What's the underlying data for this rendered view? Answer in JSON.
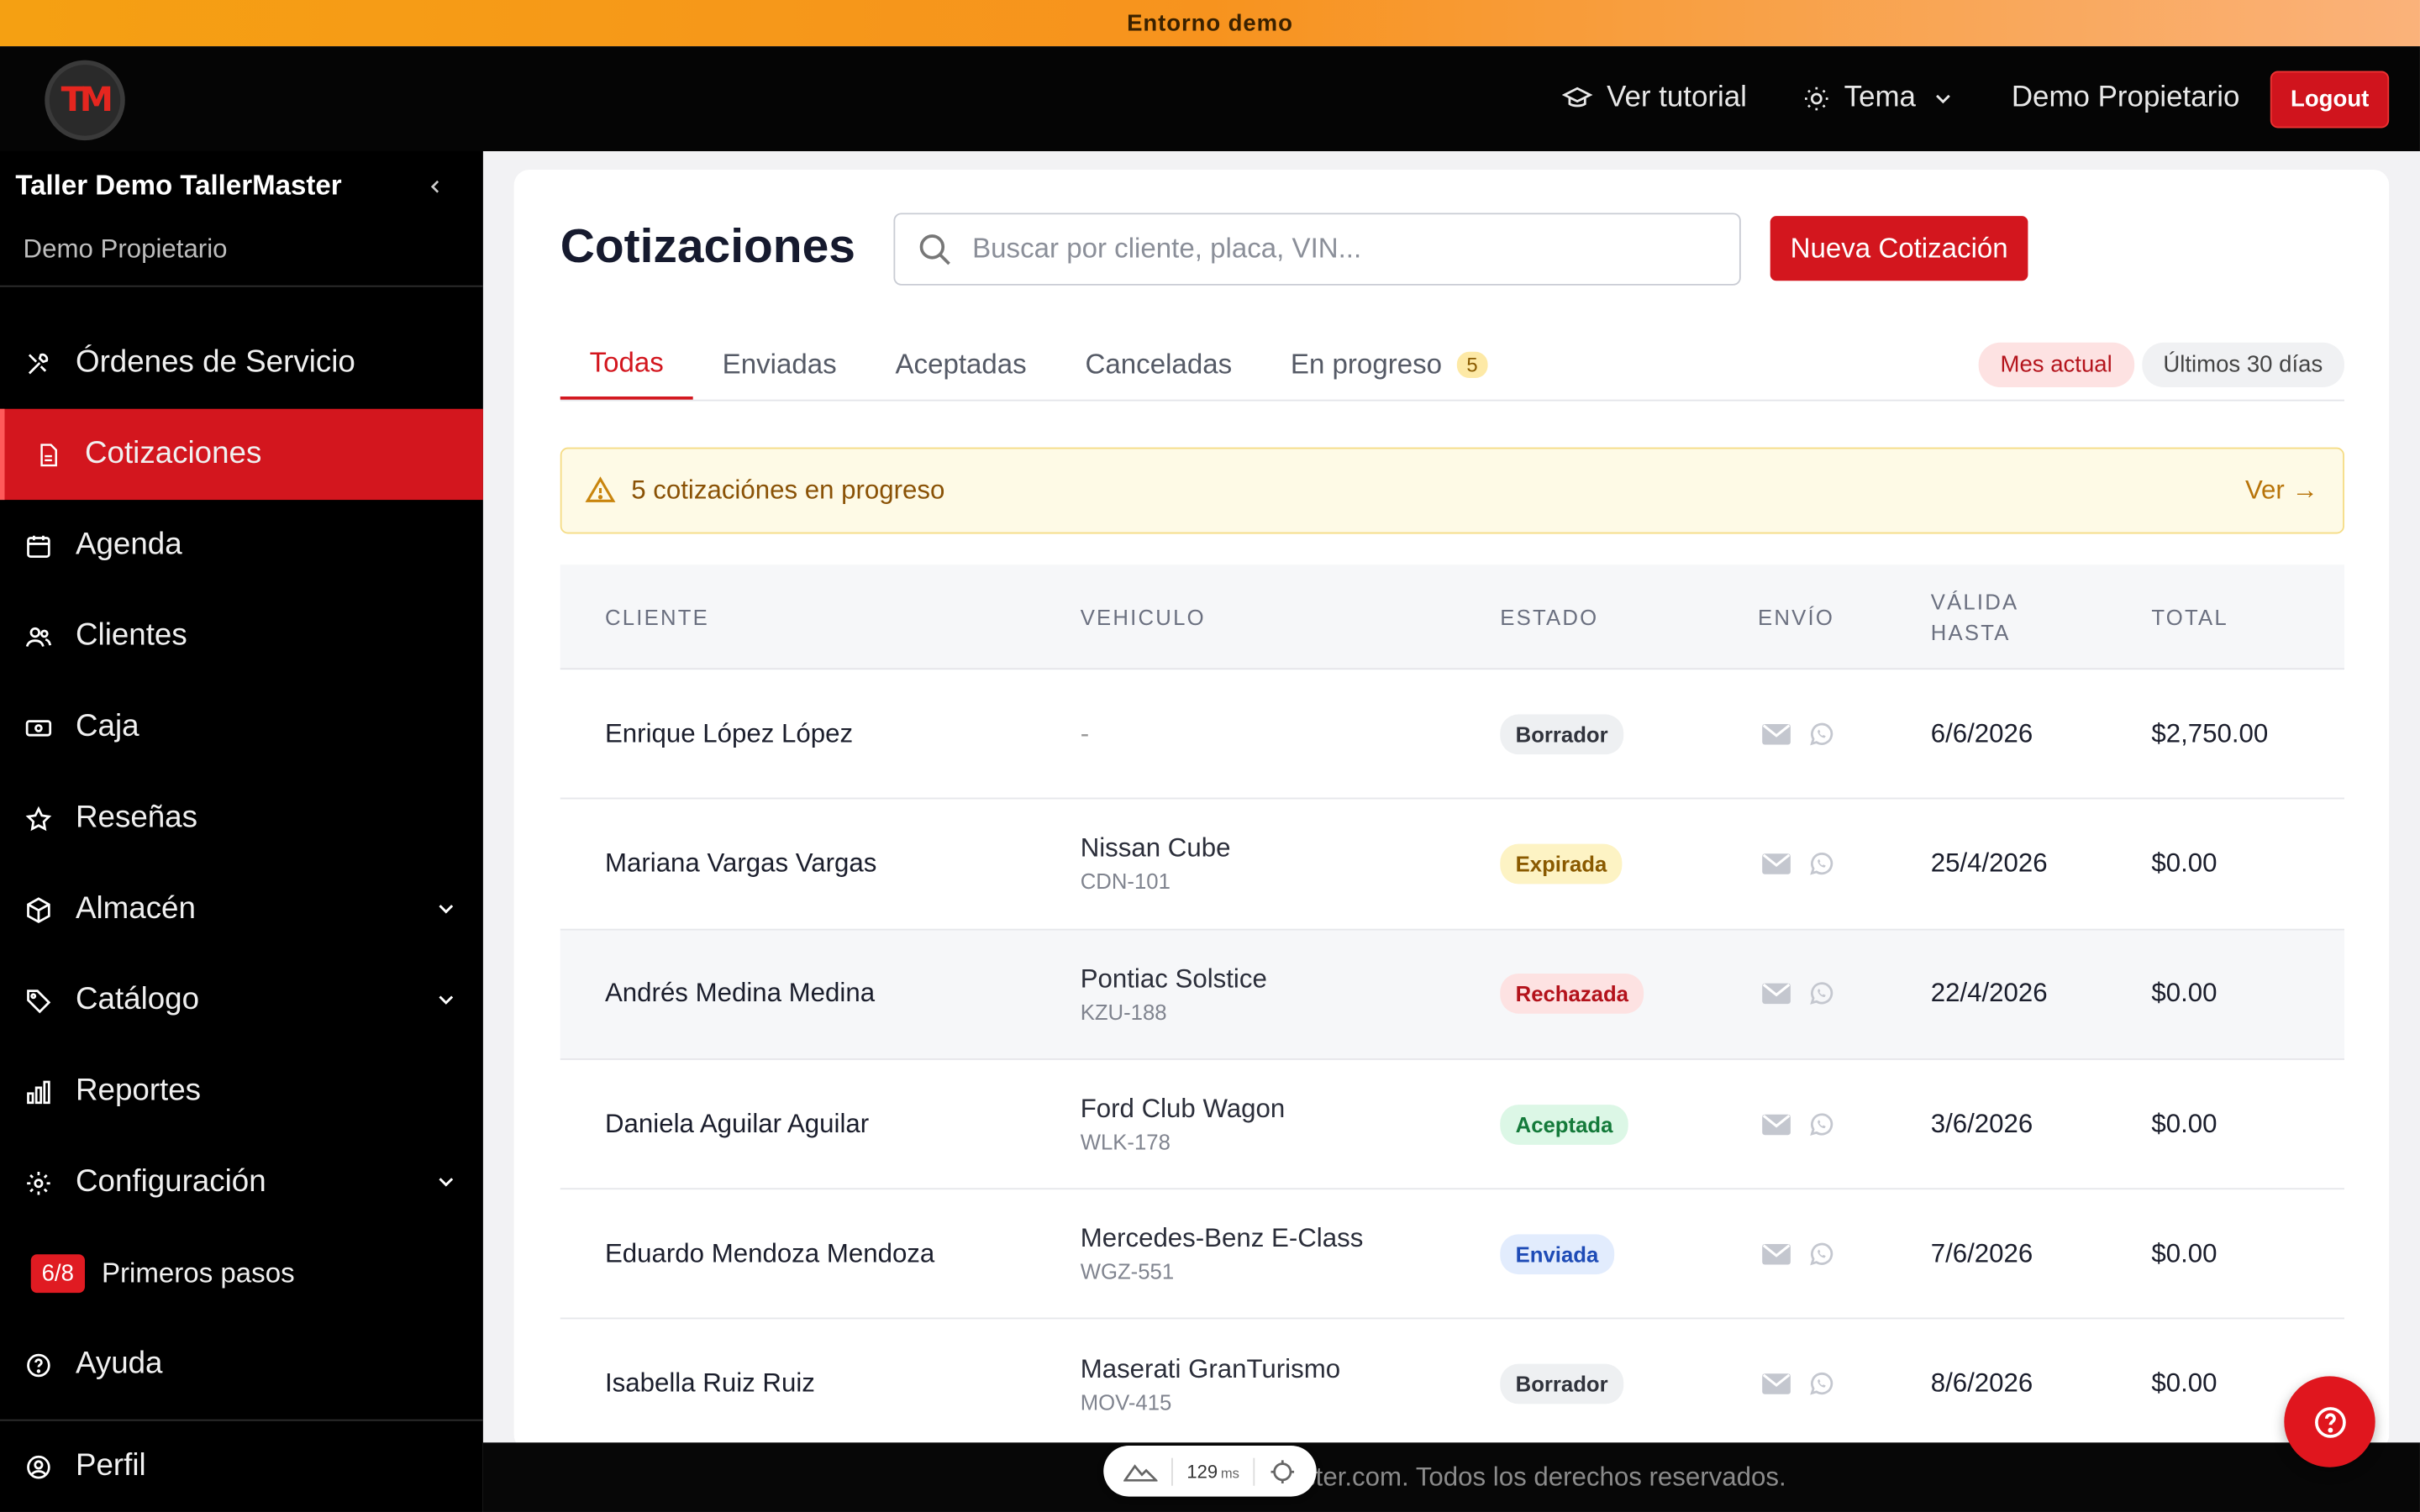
{
  "banner": {
    "text": "Entorno demo"
  },
  "topbar": {
    "logo_text": "TM",
    "tutorial_label": "Ver tutorial",
    "theme_label": "Tema",
    "user_label": "Demo Propietario",
    "logout_label": "Logout"
  },
  "sidebar": {
    "title": "Taller Demo TallerMaster",
    "subtitle": "Demo Propietario",
    "items": [
      {
        "label": "Órdenes de Servicio",
        "icon": "tools-icon"
      },
      {
        "label": "Cotizaciones",
        "icon": "document-icon"
      },
      {
        "label": "Agenda",
        "icon": "calendar-icon"
      },
      {
        "label": "Clientes",
        "icon": "users-icon"
      },
      {
        "label": "Caja",
        "icon": "cash-icon"
      },
      {
        "label": "Reseñas",
        "icon": "star-icon"
      },
      {
        "label": "Almacén",
        "icon": "box-icon"
      },
      {
        "label": "Catálogo",
        "icon": "tag-icon"
      },
      {
        "label": "Reportes",
        "icon": "chart-icon"
      },
      {
        "label": "Configuración",
        "icon": "gear-icon"
      },
      {
        "label": "Primeros pasos",
        "badge": "6/8"
      },
      {
        "label": "Ayuda",
        "icon": "help-icon"
      }
    ],
    "footer_label": "Perfil"
  },
  "page": {
    "title": "Cotizaciones",
    "search_placeholder": "Buscar por cliente, placa, VIN...",
    "new_button": "Nueva Cotización",
    "tabs": [
      {
        "label": "Todas"
      },
      {
        "label": "Enviadas"
      },
      {
        "label": "Aceptadas"
      },
      {
        "label": "Canceladas"
      },
      {
        "label": "En progreso",
        "count": "5"
      }
    ],
    "chips": [
      "Mes actual",
      "Últimos 30 días"
    ],
    "alert": {
      "text": "5 cotizaciónes en progreso",
      "link": "Ver →"
    }
  },
  "table": {
    "headers": [
      "CLIENTE",
      "VEHICULO",
      "ESTADO",
      "ENVÍO",
      "VÁLIDA HASTA",
      "TOTAL"
    ],
    "rows": [
      {
        "client": "Enrique López López",
        "vehicle": "-",
        "plate": "",
        "status": "Borrador",
        "date": "6/6/2026",
        "total": "$2,750.00"
      },
      {
        "client": "Mariana Vargas Vargas",
        "vehicle": "Nissan Cube",
        "plate": "CDN-101",
        "status": "Expirada",
        "date": "25/4/2026",
        "total": "$0.00"
      },
      {
        "client": "Andrés Medina Medina",
        "vehicle": "Pontiac Solstice",
        "plate": "KZU-188",
        "status": "Rechazada",
        "date": "22/4/2026",
        "total": "$0.00"
      },
      {
        "client": "Daniela Aguilar Aguilar",
        "vehicle": "Ford Club Wagon",
        "plate": "WLK-178",
        "status": "Aceptada",
        "date": "3/6/2026",
        "total": "$0.00"
      },
      {
        "client": "Eduardo Mendoza Mendoza",
        "vehicle": "Mercedes-Benz E-Class",
        "plate": "WGZ-551",
        "status": "Enviada",
        "date": "7/6/2026",
        "total": "$0.00"
      },
      {
        "client": "Isabella Ruiz Ruiz",
        "vehicle": "Maserati GranTurismo",
        "plate": "MOV-415",
        "status": "Borrador",
        "date": "8/6/2026",
        "total": "$0.00"
      }
    ]
  },
  "footer": {
    "text": "© 2026 tallermaster.com. Todos los derechos reservados."
  },
  "perf_widget": {
    "value": "129",
    "unit": "ms"
  },
  "colors": {
    "accent": "#d3161e",
    "banner_start": "#f5a012",
    "sidebar_bg": "#000000"
  }
}
